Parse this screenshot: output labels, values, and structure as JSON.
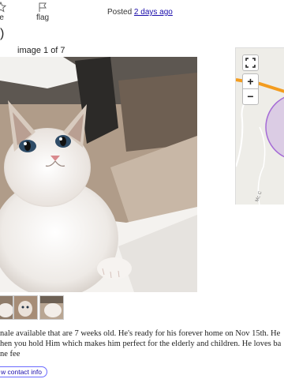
{
  "toolbar": {
    "favorite_label": "le",
    "flag_label": "flag"
  },
  "posting": {
    "posted_prefix": "Posted",
    "posted_time": "2 days ago",
    "price_fragment": ")"
  },
  "gallery": {
    "counter": "image 1 of 7"
  },
  "map": {
    "zoom_in": "+",
    "zoom_out": "−",
    "road_label": "Mc C"
  },
  "description": {
    "lines": [
      "nale available that are 7 weeks old. He's ready for his forever home on Nov 15th. He",
      "hen you hold Him which makes him perfect for the elderly and children. He loves ba",
      "ne fee"
    ]
  },
  "contact": {
    "label": "w contact info"
  },
  "colors": {
    "link": "#1a0dab",
    "map_route": "#f39c1f",
    "map_circle": "#a56bd6"
  }
}
